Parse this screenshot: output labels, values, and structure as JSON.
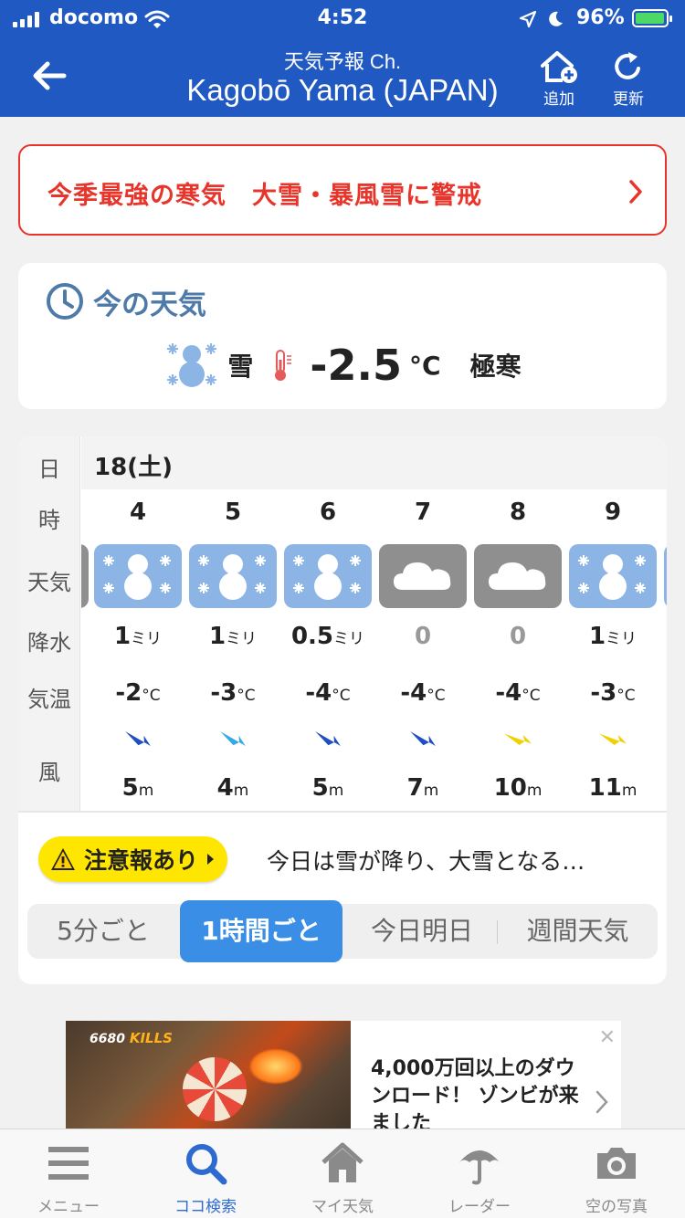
{
  "status_bar": {
    "carrier": "docomo",
    "time": "4:52",
    "battery": "96%"
  },
  "nav": {
    "subtitle": "天気予報 Ch.",
    "title": "Kagobō Yama (JAPAN)",
    "add_label": "追加",
    "refresh_label": "更新"
  },
  "alert_banner": {
    "text": "今季最強の寒気　大雪・暴風雪に警戒"
  },
  "current": {
    "heading": "今の天気",
    "condition": "雪",
    "temperature": "-2.5",
    "unit": "°C",
    "feel": "極寒"
  },
  "hourly": {
    "labels": {
      "day": "日",
      "hour": "時",
      "weather": "天気",
      "precip": "降水",
      "temp": "気温",
      "wind": "風"
    },
    "date": "18(土)",
    "hours": [
      {
        "hour": "4",
        "weather": "snow",
        "precip": "1",
        "precip_unit": "ミリ",
        "temp": "-2",
        "temp_unit": "°C",
        "wind_speed": "5",
        "wind_unit": "m",
        "wind_color": "#1f4fc2",
        "wind_angle": 30
      },
      {
        "hour": "5",
        "weather": "snow",
        "precip": "1",
        "precip_unit": "ミリ",
        "temp": "-3",
        "temp_unit": "°C",
        "wind_speed": "4",
        "wind_unit": "m",
        "wind_color": "#36a8e6",
        "wind_angle": 30
      },
      {
        "hour": "6",
        "weather": "snow",
        "precip": "0.5",
        "precip_unit": "ミリ",
        "temp": "-4",
        "temp_unit": "°C",
        "wind_speed": "5",
        "wind_unit": "m",
        "wind_color": "#1f4fc2",
        "wind_angle": 30
      },
      {
        "hour": "7",
        "weather": "cloud",
        "precip": "0",
        "precip_unit": "",
        "temp": "-4",
        "temp_unit": "°C",
        "wind_speed": "7",
        "wind_unit": "m",
        "wind_color": "#1f4fc2",
        "wind_angle": 30
      },
      {
        "hour": "8",
        "weather": "cloud",
        "precip": "0",
        "precip_unit": "",
        "temp": "-4",
        "temp_unit": "°C",
        "wind_speed": "10",
        "wind_unit": "m",
        "wind_color": "#f0d000",
        "wind_angle": 20
      },
      {
        "hour": "9",
        "weather": "snow",
        "precip": "1",
        "precip_unit": "ミリ",
        "temp": "-3",
        "temp_unit": "°C",
        "wind_speed": "11",
        "wind_unit": "m",
        "wind_color": "#f0d000",
        "wind_angle": 20
      }
    ],
    "advisory_badge": "注意報あり",
    "advisory_text": "今日は雪が降り、大雪となる…",
    "tabs": [
      {
        "label": "5分ごと",
        "active": false
      },
      {
        "label": "1時間ごと",
        "active": true
      },
      {
        "label": "今日明日",
        "active": false
      },
      {
        "label": "週間天気",
        "active": false
      }
    ]
  },
  "ad": {
    "image_text_count": "6680",
    "image_text_kills": "KILLS",
    "copy": "4,000万回以上のダウンロード！ ゾンビが来ました"
  },
  "tabbar": [
    {
      "label": "メニュー",
      "icon": "menu-icon",
      "active": false
    },
    {
      "label": "ココ検索",
      "icon": "search-icon",
      "active": true
    },
    {
      "label": "マイ天気",
      "icon": "home-icon",
      "active": false
    },
    {
      "label": "レーダー",
      "icon": "umbrella-icon",
      "active": false
    },
    {
      "label": "空の写真",
      "icon": "camera-icon",
      "active": false
    }
  ],
  "colors": {
    "brand_blue": "#2059c2",
    "alert_red": "#e8352b",
    "snow_tile": "#8cb5e6",
    "cloud_tile": "#8f8f8f",
    "advisory_yellow": "#ffe600",
    "active_tab": "#3a8ee6"
  }
}
